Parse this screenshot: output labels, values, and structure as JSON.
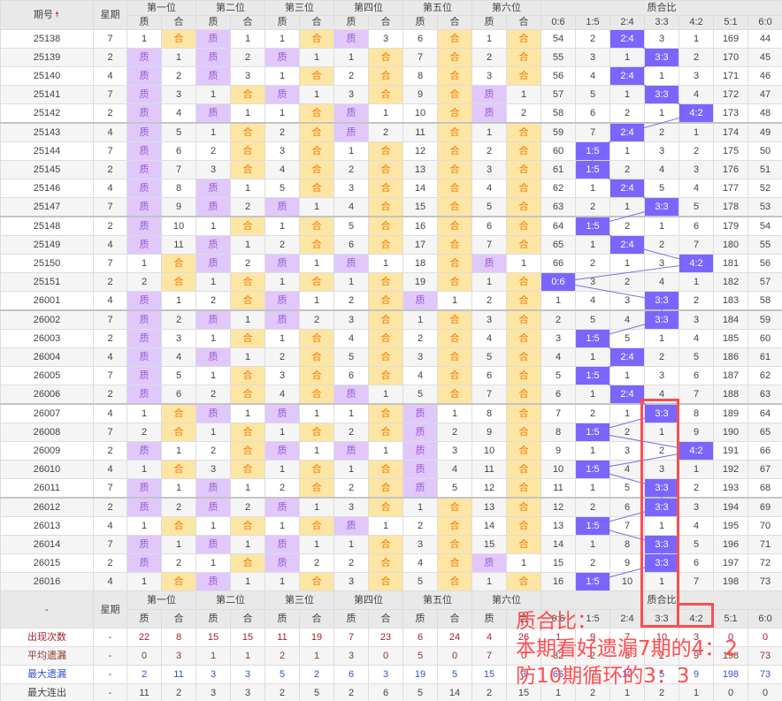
{
  "header": {
    "issue": "期号",
    "week": "星期",
    "positions": [
      "第一位",
      "第二位",
      "第三位",
      "第四位",
      "第五位",
      "第六位"
    ],
    "zhi": "质",
    "he": "合",
    "ratio_group": "质合比",
    "ratios": [
      "0:6",
      "1:5",
      "2:4",
      "3:3",
      "4:2",
      "5:1",
      "6:0"
    ]
  },
  "footer_header": {
    "issue": "-"
  },
  "colors": {
    "zhi_bg": "#e0c8fb",
    "he_bg": "#fde5a3",
    "ratio_bg": "#7a66ff",
    "annotation": "#ff4d4f"
  },
  "rows": [
    {
      "issue": "25138",
      "week": "7",
      "cells": [
        "1",
        "合",
        "质",
        "1",
        "1",
        "合",
        "质",
        "3",
        "6",
        "合",
        "1",
        "合"
      ],
      "ratio": [
        "54",
        "2",
        "2:4",
        "3",
        "1",
        "169",
        "44"
      ]
    },
    {
      "issue": "25139",
      "week": "2",
      "cells": [
        "质",
        "1",
        "质",
        "2",
        "质",
        "1",
        "1",
        "合",
        "7",
        "合",
        "2",
        "合"
      ],
      "ratio": [
        "55",
        "3",
        "1",
        "3:3",
        "2",
        "170",
        "45"
      ]
    },
    {
      "issue": "25140",
      "week": "4",
      "cells": [
        "质",
        "2",
        "质",
        "3",
        "1",
        "合",
        "2",
        "合",
        "8",
        "合",
        "3",
        "合"
      ],
      "ratio": [
        "56",
        "4",
        "2:4",
        "1",
        "3",
        "171",
        "46"
      ]
    },
    {
      "issue": "25141",
      "week": "7",
      "cells": [
        "质",
        "3",
        "1",
        "合",
        "质",
        "1",
        "3",
        "合",
        "9",
        "合",
        "质",
        "1"
      ],
      "ratio": [
        "57",
        "5",
        "1",
        "3:3",
        "4",
        "172",
        "47"
      ]
    },
    {
      "issue": "25142",
      "week": "2",
      "cells": [
        "质",
        "4",
        "质",
        "1",
        "1",
        "合",
        "质",
        "1",
        "10",
        "合",
        "质",
        "2"
      ],
      "ratio": [
        "58",
        "6",
        "2",
        "1",
        "4:2",
        "173",
        "48"
      ]
    },
    {
      "issue": "25143",
      "week": "4",
      "cells": [
        "质",
        "5",
        "1",
        "合",
        "2",
        "合",
        "质",
        "2",
        "11",
        "合",
        "1",
        "合"
      ],
      "ratio": [
        "59",
        "7",
        "2:4",
        "2",
        "1",
        "174",
        "49"
      ]
    },
    {
      "issue": "25144",
      "week": "7",
      "cells": [
        "质",
        "6",
        "2",
        "合",
        "3",
        "合",
        "1",
        "合",
        "12",
        "合",
        "2",
        "合"
      ],
      "ratio": [
        "60",
        "1:5",
        "1",
        "3",
        "2",
        "175",
        "50"
      ]
    },
    {
      "issue": "25145",
      "week": "2",
      "cells": [
        "质",
        "7",
        "3",
        "合",
        "4",
        "合",
        "2",
        "合",
        "13",
        "合",
        "3",
        "合"
      ],
      "ratio": [
        "61",
        "1:5",
        "2",
        "4",
        "3",
        "176",
        "51"
      ]
    },
    {
      "issue": "25146",
      "week": "4",
      "cells": [
        "质",
        "8",
        "质",
        "1",
        "5",
        "合",
        "3",
        "合",
        "14",
        "合",
        "4",
        "合"
      ],
      "ratio": [
        "62",
        "1",
        "2:4",
        "5",
        "4",
        "177",
        "52"
      ]
    },
    {
      "issue": "25147",
      "week": "7",
      "cells": [
        "质",
        "9",
        "质",
        "2",
        "质",
        "1",
        "4",
        "合",
        "15",
        "合",
        "5",
        "合"
      ],
      "ratio": [
        "63",
        "2",
        "1",
        "3:3",
        "5",
        "178",
        "53"
      ]
    },
    {
      "issue": "25148",
      "week": "2",
      "cells": [
        "质",
        "10",
        "1",
        "合",
        "1",
        "合",
        "5",
        "合",
        "16",
        "合",
        "6",
        "合"
      ],
      "ratio": [
        "64",
        "1:5",
        "2",
        "1",
        "6",
        "179",
        "54"
      ]
    },
    {
      "issue": "25149",
      "week": "4",
      "cells": [
        "质",
        "11",
        "质",
        "1",
        "2",
        "合",
        "6",
        "合",
        "17",
        "合",
        "7",
        "合"
      ],
      "ratio": [
        "65",
        "1",
        "2:4",
        "2",
        "7",
        "180",
        "55"
      ]
    },
    {
      "issue": "25150",
      "week": "7",
      "cells": [
        "1",
        "合",
        "质",
        "2",
        "质",
        "1",
        "质",
        "1",
        "18",
        "合",
        "质",
        "1"
      ],
      "ratio": [
        "66",
        "2",
        "1",
        "3",
        "4:2",
        "181",
        "56"
      ]
    },
    {
      "issue": "25151",
      "week": "2",
      "cells": [
        "2",
        "合",
        "1",
        "合",
        "1",
        "合",
        "1",
        "合",
        "19",
        "合",
        "1",
        "合"
      ],
      "ratio": [
        "0:6",
        "3",
        "2",
        "4",
        "1",
        "182",
        "57"
      ]
    },
    {
      "issue": "26001",
      "week": "4",
      "cells": [
        "质",
        "1",
        "2",
        "合",
        "质",
        "1",
        "2",
        "合",
        "质",
        "1",
        "2",
        "合"
      ],
      "ratio": [
        "1",
        "4",
        "3",
        "3:3",
        "2",
        "183",
        "58"
      ]
    },
    {
      "issue": "26002",
      "week": "7",
      "cells": [
        "质",
        "2",
        "质",
        "1",
        "质",
        "2",
        "3",
        "合",
        "1",
        "合",
        "3",
        "合"
      ],
      "ratio": [
        "2",
        "5",
        "4",
        "3:3",
        "3",
        "184",
        "59"
      ]
    },
    {
      "issue": "26003",
      "week": "2",
      "cells": [
        "质",
        "3",
        "1",
        "合",
        "1",
        "合",
        "4",
        "合",
        "2",
        "合",
        "4",
        "合"
      ],
      "ratio": [
        "3",
        "1:5",
        "5",
        "1",
        "4",
        "185",
        "60"
      ]
    },
    {
      "issue": "26004",
      "week": "4",
      "cells": [
        "质",
        "4",
        "质",
        "1",
        "2",
        "合",
        "5",
        "合",
        "3",
        "合",
        "5",
        "合"
      ],
      "ratio": [
        "4",
        "1",
        "2:4",
        "2",
        "5",
        "186",
        "61"
      ]
    },
    {
      "issue": "26005",
      "week": "7",
      "cells": [
        "质",
        "5",
        "1",
        "合",
        "3",
        "合",
        "6",
        "合",
        "4",
        "合",
        "6",
        "合"
      ],
      "ratio": [
        "5",
        "1:5",
        "1",
        "3",
        "6",
        "187",
        "62"
      ]
    },
    {
      "issue": "26006",
      "week": "2",
      "cells": [
        "质",
        "6",
        "2",
        "合",
        "4",
        "合",
        "质",
        "1",
        "5",
        "合",
        "7",
        "合"
      ],
      "ratio": [
        "6",
        "1",
        "2:4",
        "4",
        "7",
        "188",
        "63"
      ]
    },
    {
      "issue": "26007",
      "week": "4",
      "cells": [
        "1",
        "合",
        "质",
        "1",
        "质",
        "1",
        "1",
        "合",
        "质",
        "1",
        "8",
        "合"
      ],
      "ratio": [
        "7",
        "2",
        "1",
        "3:3",
        "8",
        "189",
        "64"
      ]
    },
    {
      "issue": "26008",
      "week": "7",
      "cells": [
        "2",
        "合",
        "1",
        "合",
        "1",
        "合",
        "2",
        "合",
        "质",
        "2",
        "9",
        "合"
      ],
      "ratio": [
        "8",
        "1:5",
        "2",
        "1",
        "9",
        "190",
        "65"
      ]
    },
    {
      "issue": "26009",
      "week": "2",
      "cells": [
        "质",
        "1",
        "2",
        "合",
        "质",
        "1",
        "质",
        "1",
        "质",
        "3",
        "10",
        "合"
      ],
      "ratio": [
        "9",
        "1",
        "3",
        "2",
        "4:2",
        "191",
        "66"
      ]
    },
    {
      "issue": "26010",
      "week": "4",
      "cells": [
        "1",
        "合",
        "3",
        "合",
        "1",
        "合",
        "1",
        "合",
        "质",
        "4",
        "11",
        "合"
      ],
      "ratio": [
        "10",
        "1:5",
        "4",
        "3",
        "1",
        "192",
        "67"
      ]
    },
    {
      "issue": "26011",
      "week": "7",
      "cells": [
        "质",
        "1",
        "质",
        "1",
        "2",
        "合",
        "2",
        "合",
        "质",
        "5",
        "12",
        "合"
      ],
      "ratio": [
        "11",
        "1",
        "5",
        "3:3",
        "2",
        "193",
        "68"
      ]
    },
    {
      "issue": "26012",
      "week": "2",
      "cells": [
        "质",
        "2",
        "质",
        "2",
        "质",
        "1",
        "3",
        "合",
        "1",
        "合",
        "13",
        "合"
      ],
      "ratio": [
        "12",
        "2",
        "6",
        "3:3",
        "3",
        "194",
        "69"
      ]
    },
    {
      "issue": "26013",
      "week": "4",
      "cells": [
        "1",
        "合",
        "1",
        "合",
        "1",
        "合",
        "质",
        "1",
        "2",
        "合",
        "14",
        "合"
      ],
      "ratio": [
        "13",
        "1:5",
        "7",
        "1",
        "4",
        "195",
        "70"
      ]
    },
    {
      "issue": "26014",
      "week": "7",
      "cells": [
        "质",
        "1",
        "质",
        "1",
        "质",
        "1",
        "1",
        "合",
        "3",
        "合",
        "15",
        "合"
      ],
      "ratio": [
        "14",
        "1",
        "8",
        "3:3",
        "5",
        "196",
        "71"
      ]
    },
    {
      "issue": "26015",
      "week": "2",
      "cells": [
        "质",
        "2",
        "1",
        "合",
        "质",
        "2",
        "2",
        "合",
        "4",
        "合",
        "质",
        "1"
      ],
      "ratio": [
        "15",
        "2",
        "9",
        "3:3",
        "6",
        "197",
        "72"
      ]
    },
    {
      "issue": "26016",
      "week": "4",
      "cells": [
        "1",
        "合",
        "质",
        "1",
        "1",
        "合",
        "3",
        "合",
        "5",
        "合",
        "1",
        "合"
      ],
      "ratio": [
        "16",
        "1:5",
        "10",
        "1",
        "7",
        "198",
        "73"
      ]
    }
  ],
  "stats": [
    {
      "key": "appear",
      "label": "出现次数",
      "values": [
        "-",
        "22",
        "8",
        "15",
        "15",
        "11",
        "19",
        "7",
        "23",
        "6",
        "24",
        "4",
        "26",
        "1",
        "9",
        "7",
        "10",
        "3",
        "0",
        "0"
      ]
    },
    {
      "key": "avg",
      "label": "平均遗漏",
      "values": [
        "-",
        "0",
        "3",
        "1",
        "1",
        "2",
        "1",
        "3",
        "0",
        "5",
        "0",
        "7",
        "0",
        "32",
        "2",
        "3",
        "2",
        "9",
        "198",
        "73"
      ]
    },
    {
      "key": "max",
      "label": "最大遗漏",
      "values": [
        "-",
        "2",
        "11",
        "3",
        "3",
        "5",
        "2",
        "6",
        "3",
        "19",
        "5",
        "15",
        "3",
        "66",
        "7",
        "10",
        "5",
        "9",
        "198",
        "73"
      ]
    },
    {
      "key": "run",
      "label": "最大连出",
      "values": [
        "-",
        "11",
        "2",
        "3",
        "3",
        "2",
        "5",
        "2",
        "6",
        "5",
        "14",
        "2",
        "15",
        "1",
        "2",
        "1",
        "2",
        "1",
        "0",
        "0"
      ]
    }
  ],
  "annotation": {
    "line1": "质合比：",
    "line2": "本期看好遗漏7期的4：2",
    "line3": "防10期循环的3：3"
  }
}
